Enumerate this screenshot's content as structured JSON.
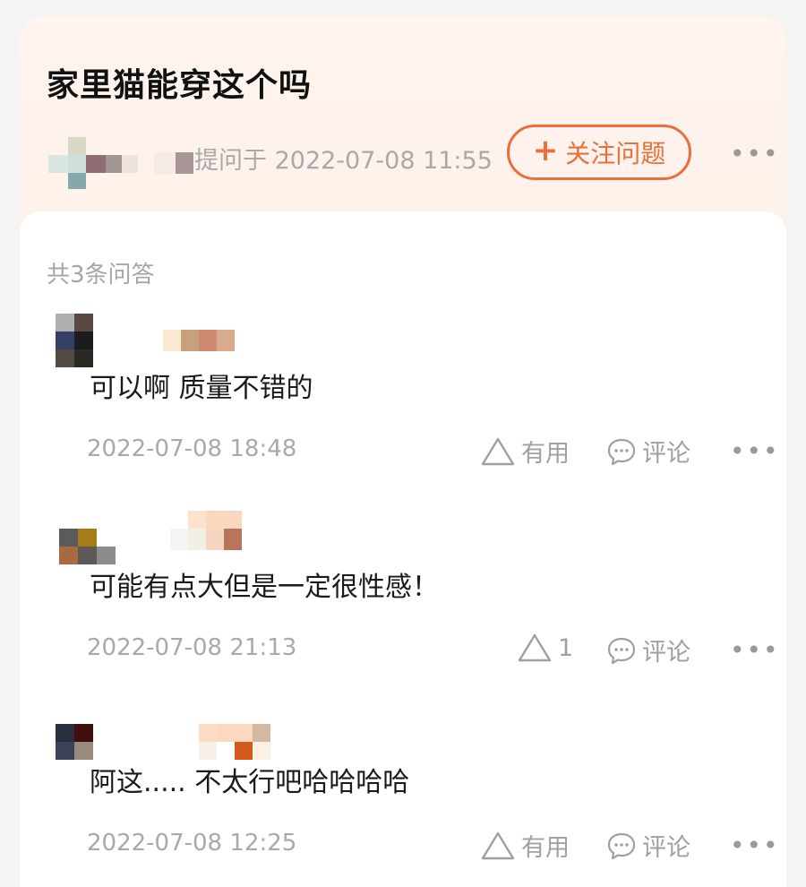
{
  "question": {
    "title": "家里猫能穿这个吗",
    "asked_at": "提问于 2022-07-08 11:55",
    "follow_label": "关注问题",
    "follow_icon": "plus-icon",
    "accent": "#e8703a"
  },
  "answers_count": "共3条问答",
  "answers": [
    {
      "text": "可以啊 质量不错的",
      "time": "2022-07-08 18:48",
      "useful_label": "有用",
      "comment_label": "评论"
    },
    {
      "text": "可能有点大但是一定很性感！",
      "time": "2022-07-08 21:13",
      "useful_label": "1",
      "comment_label": "评论"
    },
    {
      "text": "阿这..... 不太行吧哈哈哈哈",
      "time": "2022-07-08 12:25",
      "useful_label": "有用",
      "comment_label": "评论"
    }
  ],
  "more_glyph": "•••"
}
